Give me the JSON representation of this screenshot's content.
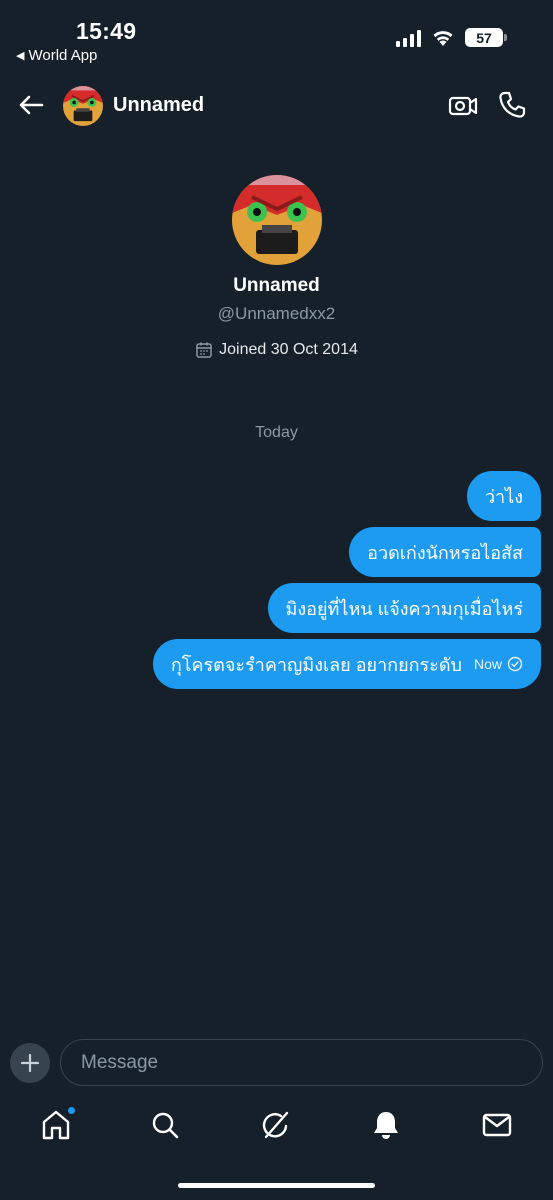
{
  "status_bar": {
    "time": "15:49",
    "back_app": "World App",
    "battery": "57"
  },
  "header": {
    "name": "Unnamed"
  },
  "profile": {
    "name": "Unnamed",
    "handle": "@Unnamedxx2",
    "joined": "Joined 30 Oct 2014"
  },
  "conversation": {
    "day_separator": "Today",
    "messages": [
      {
        "text": "ว่าไง"
      },
      {
        "text": "อวดเก่งนักหรอไอสัส"
      },
      {
        "text": "มิงอยู่ที่ไหน แจ้งความกุเมื่อไหร่"
      },
      {
        "text": "กุโครตจะรำคาญมิงเลย อยากยกระดับ",
        "time": "Now"
      }
    ]
  },
  "composer": {
    "placeholder": "Message"
  },
  "icons": {
    "back": "arrow-left-icon",
    "video": "video-call-icon",
    "phone": "phone-icon",
    "calendar": "calendar-icon",
    "plus": "plus-icon",
    "home": "home-icon",
    "search": "search-icon",
    "grok": "grok-icon",
    "notifications": "bell-icon",
    "messages": "mail-icon"
  },
  "colors": {
    "background": "#15202b",
    "accent": "#1d9bf0",
    "muted": "#8b98a5",
    "border": "#38444d"
  }
}
